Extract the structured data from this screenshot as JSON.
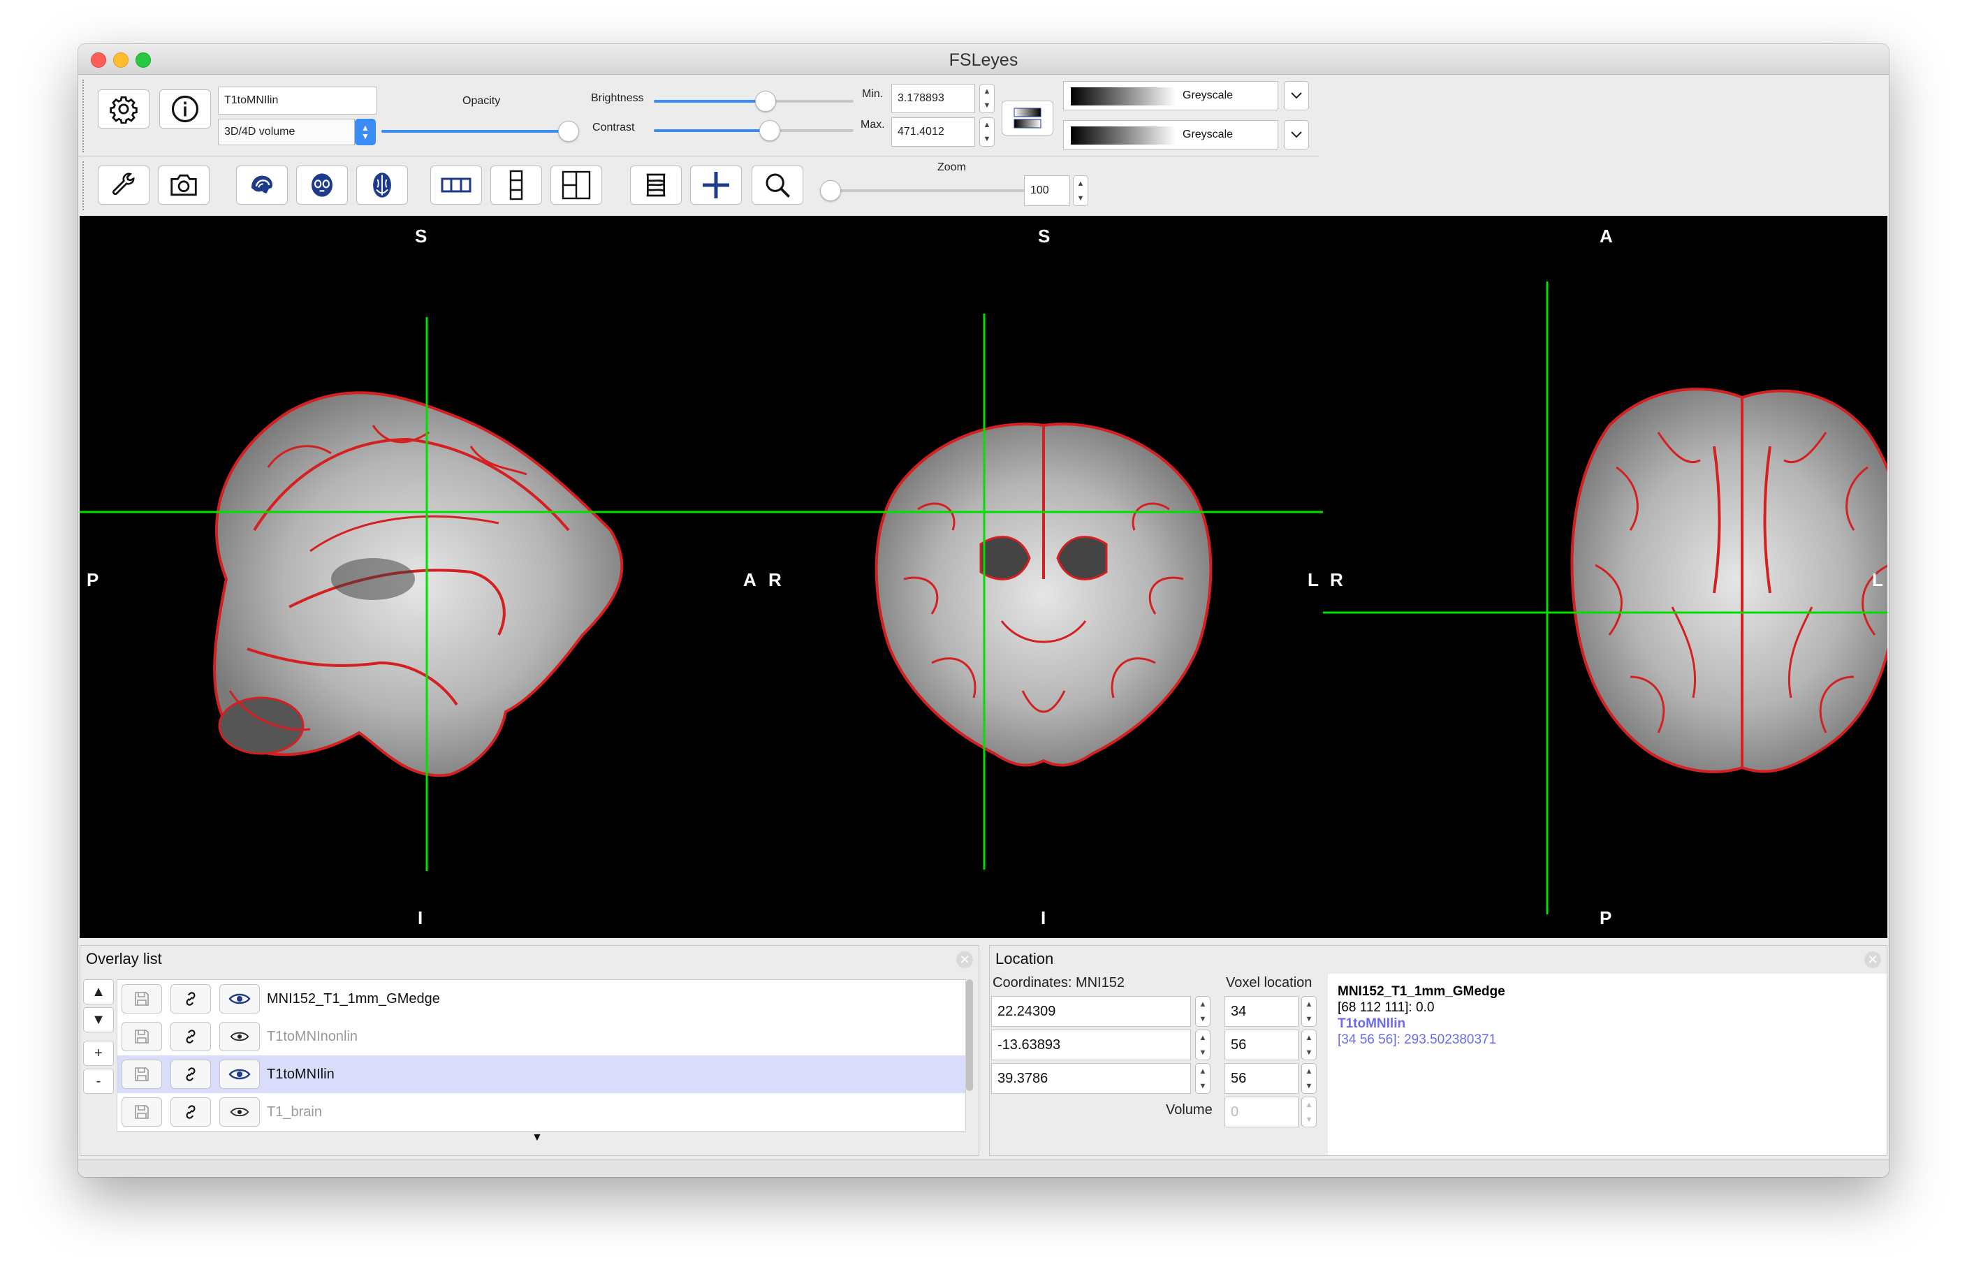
{
  "window": {
    "title": "FSLeyes"
  },
  "toolbar": {
    "overlay_name": "T1toMNIlin",
    "overlay_type": "3D/4D volume",
    "opacity_label": "Opacity",
    "opacity_value": 0.95,
    "brightness_label": "Brightness",
    "brightness_value": 0.56,
    "contrast_label": "Contrast",
    "contrast_value": 0.58,
    "min_label": "Min.",
    "min_value": "3.178893",
    "max_label": "Max.",
    "max_value": "471.4012",
    "cmap1_label": "Greyscale",
    "cmap2_label": "Greyscale",
    "zoom_label": "Zoom",
    "zoom_value": "100",
    "icons": [
      "gear-icon",
      "info-icon",
      "wrench-icon",
      "camera-icon",
      "sagittal-view-icon",
      "coronal-view-icon",
      "axial-view-icon",
      "horizontal-layout-icon",
      "vertical-layout-icon",
      "grid-layout-icon",
      "movie-icon",
      "cursor-cross-icon",
      "zoom-icon"
    ]
  },
  "canvas": {
    "sagittal": {
      "top": "S",
      "bottom": "I",
      "left": "P",
      "right": "A"
    },
    "coronal": {
      "top": "S",
      "bottom": "I",
      "left": "R",
      "right": "L"
    },
    "axial": {
      "top": "A",
      "bottom": "P",
      "left": "R",
      "right": "L"
    },
    "cursor_color": "#00e000",
    "edge_color": "#d42020"
  },
  "overlay_list": {
    "title": "Overlay list",
    "buttons": [
      "▲",
      "▼",
      "+",
      "-"
    ],
    "items": [
      {
        "name": "MNI152_T1_1mm_GMedge",
        "visible": true,
        "selected": false
      },
      {
        "name": "T1toMNInonlin",
        "visible": false,
        "selected": false
      },
      {
        "name": "T1toMNIlin",
        "visible": true,
        "selected": true
      },
      {
        "name": "T1_brain",
        "visible": false,
        "selected": false
      }
    ]
  },
  "location": {
    "title": "Location",
    "coords_label": "Coordinates: MNI152",
    "voxel_label": "Voxel location",
    "coords": [
      "22.24309",
      "-13.63893",
      "39.3786"
    ],
    "voxels": [
      "34",
      "56",
      "56"
    ],
    "volume_label": "Volume",
    "volume_value": "0",
    "info": [
      {
        "text": "MNI152_T1_1mm_GMedge",
        "bold": true,
        "color": "#000000"
      },
      {
        "text": "[68 112 111]: 0.0",
        "bold": false,
        "color": "#000000"
      },
      {
        "text": "T1toMNIlin",
        "bold": true,
        "color": "#6b6bf0"
      },
      {
        "text": "[34 56 56]: 293.502380371",
        "bold": false,
        "color": "#6b6bf0"
      }
    ]
  }
}
